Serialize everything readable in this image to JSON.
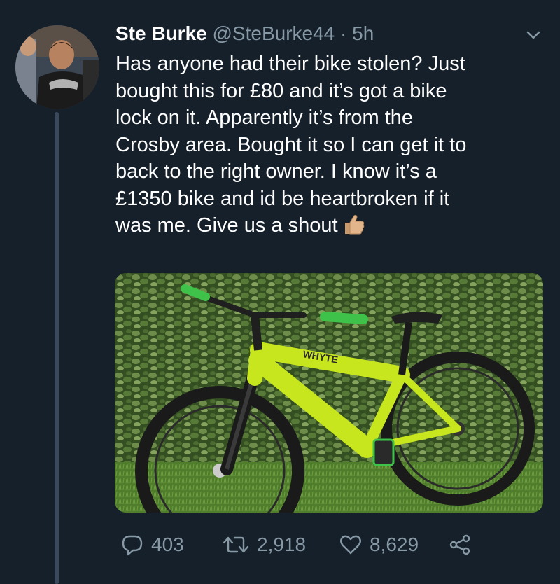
{
  "tweet": {
    "display_name": "Ste Burke",
    "handle": "@SteBurke44",
    "separator": "·",
    "time": "5h",
    "text_lines": [
      "Has anyone had their bike stolen? Just",
      "bought this for £80 and it’s got a bike",
      "lock on it. Apparently it’s from the",
      "Crosby area. Bought it so I can get it to",
      "back to the right owner. I know it’s a",
      "£1350 bike and id be heartbroken if it",
      "was me. Give us a shout"
    ],
    "emoji": "thumbs-up-icon"
  },
  "media": {
    "bike_brand": "WHYTE",
    "icon": "bike-photo"
  },
  "actions": {
    "replies": "403",
    "retweets": "2,918",
    "likes": "8,629"
  },
  "colors": {
    "background": "#15202b",
    "text": "#ffffff",
    "muted": "#8899a6",
    "thread_line": "#3a4a5c",
    "bike_frame": "#c8e61e"
  }
}
